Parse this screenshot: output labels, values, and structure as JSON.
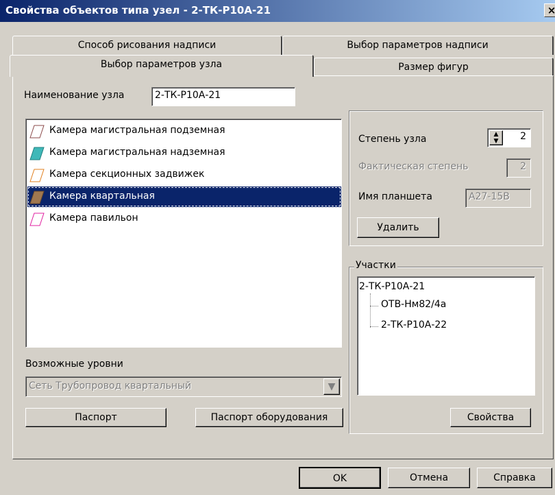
{
  "window": {
    "title": "Свойства объектов типа узел - 2-ТК-Р10А-21",
    "close_label": "×"
  },
  "tabs": [
    {
      "label": "Способ рисования надписи"
    },
    {
      "label": "Выбор параметров надписи"
    },
    {
      "label": "Выбор параметров узла"
    },
    {
      "label": "Размер фигур"
    }
  ],
  "node_name": {
    "label": "Наименование узла",
    "value": "2-ТК-Р10А-21"
  },
  "node_types": [
    {
      "label": "Камера магистральная подземная",
      "icon_color": "#8b4a4a",
      "fill": "none"
    },
    {
      "label": "Камера магистральная надземная",
      "icon_color": "#208080",
      "fill": "#3fb8b8"
    },
    {
      "label": "Камера секционных задвижек",
      "icon_color": "#e08020",
      "fill": "none"
    },
    {
      "label": "Камера квартальная",
      "icon_color": "#6b4a2a",
      "fill": "#a07850",
      "selected": true
    },
    {
      "label": "Камера павильон",
      "icon_color": "#e020a0",
      "fill": "none"
    }
  ],
  "degree": {
    "label": "Степень узла",
    "value": "2"
  },
  "actual_degree": {
    "label": "Фактическая степень",
    "value": "2"
  },
  "tablet": {
    "label": "Имя планшета",
    "value": "А27-15В"
  },
  "delete_button": "Удалить",
  "sections": {
    "label": "Участки",
    "root": "2-ТК-Р10А-21",
    "children": [
      "ОТВ-Нм82/4а",
      "2-ТК-Р10А-22"
    ]
  },
  "levels": {
    "label": "Возможные уровни",
    "value": "Сеть Трубопровод квартальный"
  },
  "buttons": {
    "passport": "Паспорт",
    "equipment_passport": "Паспорт оборудования",
    "properties": "Свойства",
    "ok": "OK",
    "cancel": "Отмена",
    "help": "Справка"
  }
}
